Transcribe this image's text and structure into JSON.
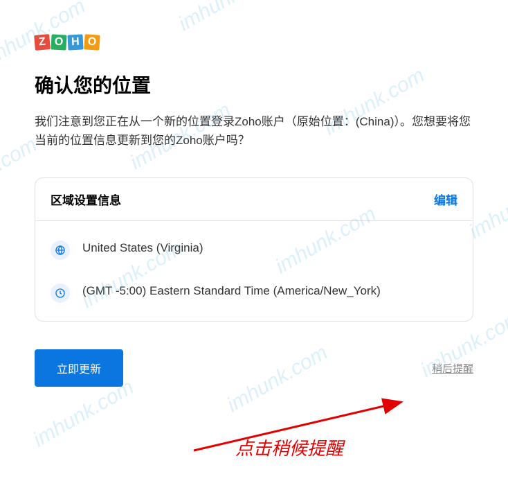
{
  "logo": {
    "letters": [
      "Z",
      "O",
      "H",
      "O"
    ]
  },
  "page": {
    "title": "确认您的位置",
    "description": "我们注意到您正在从一个新的位置登录Zoho账户（原始位置：(China)）。您想要将您当前的位置信息更新到您的Zoho账户吗？"
  },
  "card": {
    "header_title": "区域设置信息",
    "edit_label": "编辑",
    "location": "United States (Virginia)",
    "timezone": "(GMT -5:00) Eastern Standard Time (America/New_York)"
  },
  "actions": {
    "primary": "立即更新",
    "secondary": "稍后提醒"
  },
  "annotation": {
    "text": "点击稍候提醒"
  },
  "watermark": "imhunk.com"
}
